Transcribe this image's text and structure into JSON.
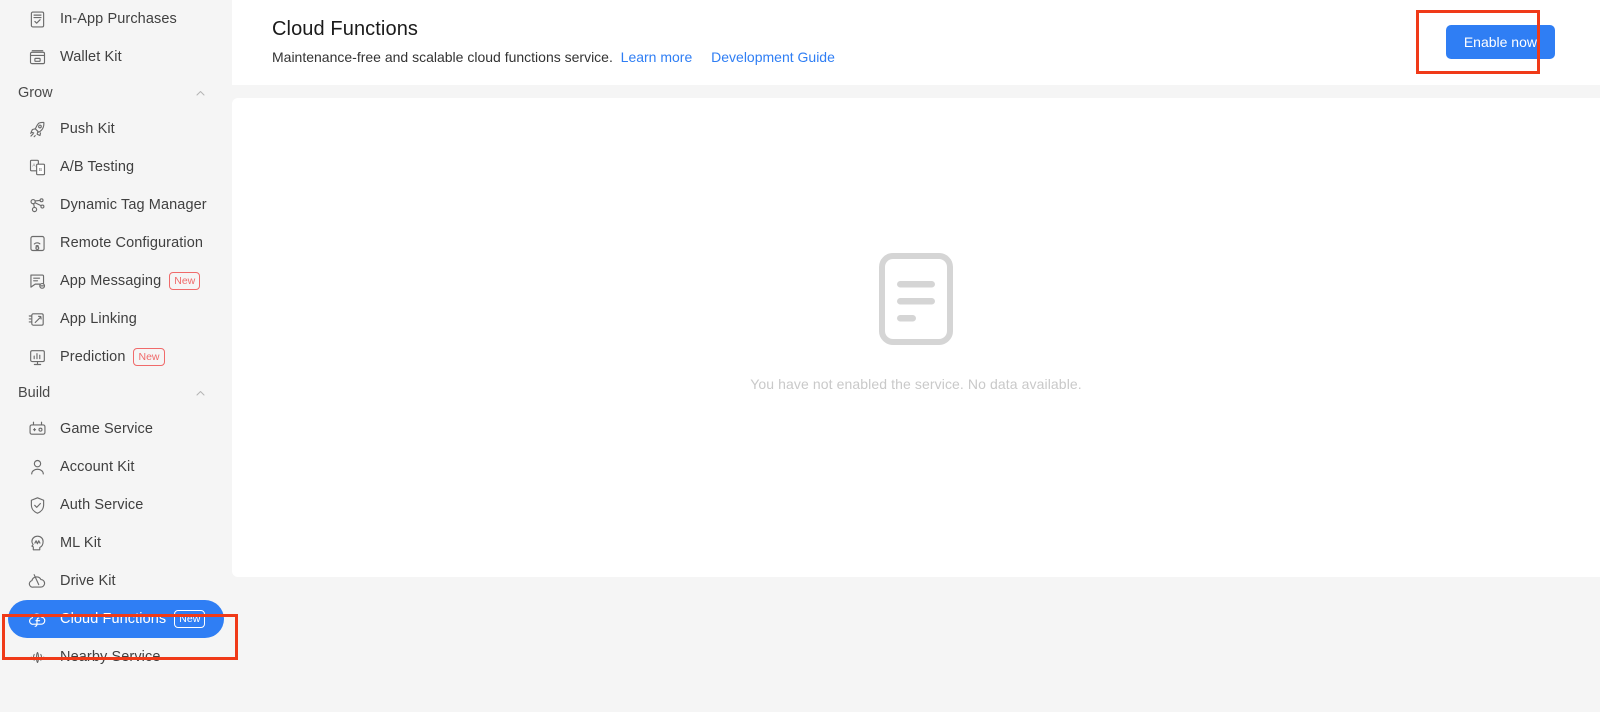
{
  "sidebar": {
    "items": [
      {
        "type": "item",
        "label": "In-App Purchases",
        "icon": "in-app-purchases-icon",
        "badge": null,
        "active": false
      },
      {
        "type": "item",
        "label": "Wallet Kit",
        "icon": "wallet-kit-icon",
        "badge": null,
        "active": false
      },
      {
        "type": "section",
        "label": "Grow",
        "dot": true,
        "collapse_icon": "chevron-up-icon"
      },
      {
        "type": "item",
        "label": "Push Kit",
        "icon": "rocket-icon",
        "badge": null,
        "active": false
      },
      {
        "type": "item",
        "label": "A/B Testing",
        "icon": "ab-testing-icon",
        "badge": null,
        "active": false
      },
      {
        "type": "item",
        "label": "Dynamic Tag Manager",
        "icon": "tag-manager-icon",
        "badge": null,
        "active": false
      },
      {
        "type": "item",
        "label": "Remote Configuration",
        "icon": "remote-config-icon",
        "badge": null,
        "active": false
      },
      {
        "type": "item",
        "label": "App Messaging",
        "icon": "app-messaging-icon",
        "badge": "New",
        "active": false
      },
      {
        "type": "item",
        "label": "App Linking",
        "icon": "app-linking-icon",
        "badge": null,
        "active": false
      },
      {
        "type": "item",
        "label": "Prediction",
        "icon": "prediction-icon",
        "badge": "New",
        "active": false
      },
      {
        "type": "section",
        "label": "Build",
        "dot": true,
        "collapse_icon": "chevron-up-icon"
      },
      {
        "type": "item",
        "label": "Game Service",
        "icon": "gamepad-icon",
        "badge": null,
        "active": false
      },
      {
        "type": "item",
        "label": "Account Kit",
        "icon": "person-icon",
        "badge": null,
        "active": false
      },
      {
        "type": "item",
        "label": "Auth Service",
        "icon": "shield-check-icon",
        "badge": null,
        "active": false
      },
      {
        "type": "item",
        "label": "ML Kit",
        "icon": "ml-head-icon",
        "badge": null,
        "active": false
      },
      {
        "type": "item",
        "label": "Drive Kit",
        "icon": "cloud-drive-icon",
        "badge": null,
        "active": false
      },
      {
        "type": "item",
        "label": "Cloud Functions",
        "icon": "cloud-functions-icon",
        "badge": "New",
        "active": true
      },
      {
        "type": "item",
        "label": "Nearby Service",
        "icon": "nearby-service-icon",
        "badge": null,
        "active": false
      }
    ]
  },
  "header": {
    "title": "Cloud Functions",
    "description": "Maintenance-free and scalable cloud functions service.",
    "learn_more": "Learn more",
    "development_guide": "Development Guide",
    "enable_button": "Enable now"
  },
  "main": {
    "empty_icon": "document-placeholder-icon",
    "empty_message": "You have not enabled the service. No data available."
  },
  "colors": {
    "accent_blue": "#2f7ef4",
    "annotation_red": "#f03a18",
    "badge_red": "#f06a6a",
    "sidebar_bg": "#f5f5f5",
    "page_bg": "#f5f5f5",
    "empty_gray": "#c9c9c9"
  },
  "annotations": [
    {
      "name": "enable-now-highlight",
      "target": "Enable now"
    },
    {
      "name": "cloud-functions-highlight",
      "target": "Cloud Functions"
    }
  ]
}
